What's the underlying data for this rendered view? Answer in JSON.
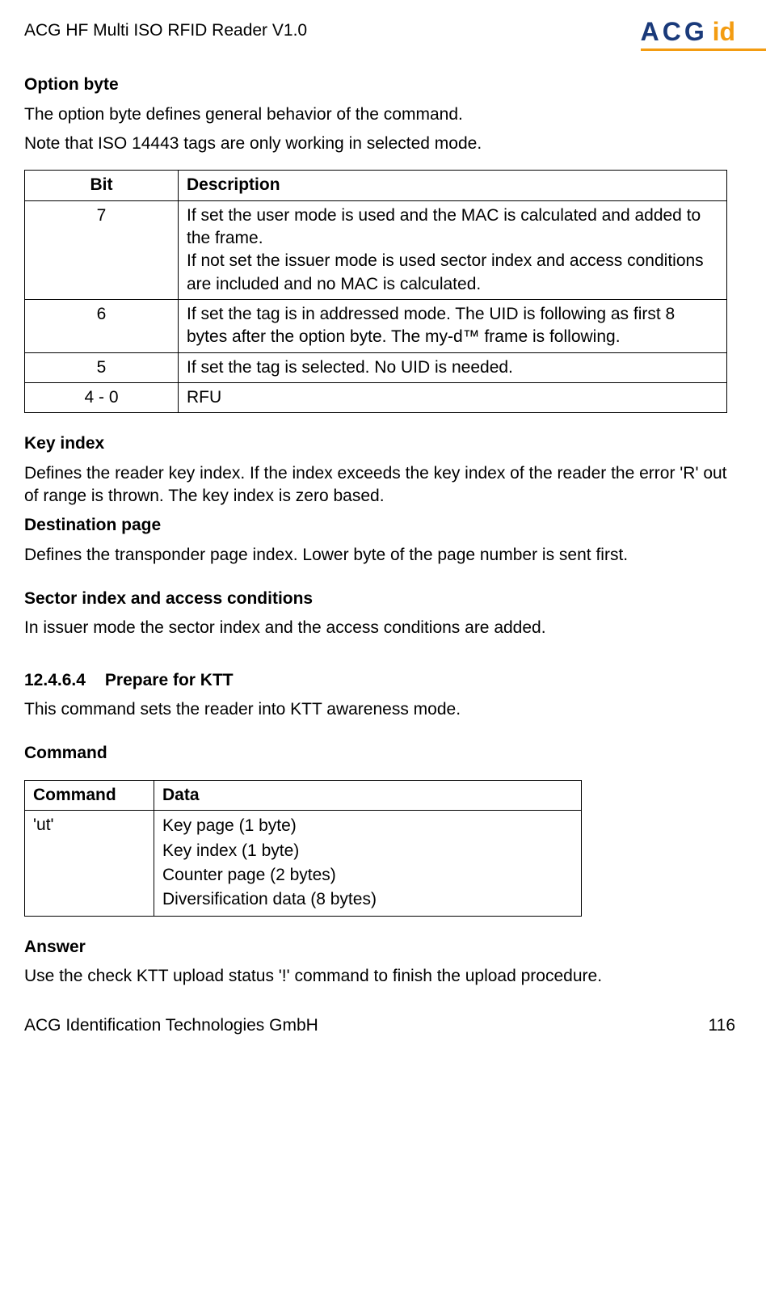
{
  "header": {
    "doc_title": "ACG HF Multi ISO RFID Reader V1.0",
    "logo_text_1": "ACG",
    "logo_text_2": "id"
  },
  "option_byte": {
    "heading": "Option byte",
    "p1": "The option byte defines general behavior of the command.",
    "p2": "Note that ISO 14443 tags are only working in selected mode.",
    "table": {
      "head_bit": "Bit",
      "head_desc": "Description",
      "rows": [
        {
          "bit": "7",
          "desc": "If set the user mode is used and the MAC is calculated and added to the frame.\nIf not set the issuer mode is used sector index and access conditions are included and no MAC is calculated."
        },
        {
          "bit": "6",
          "desc": "If set the tag is in addressed mode. The UID is following as first 8 bytes after the option byte. The my-d™ frame is following."
        },
        {
          "bit": "5",
          "desc": "If set the tag is selected. No UID is needed."
        },
        {
          "bit": "4 - 0",
          "desc": "RFU"
        }
      ]
    }
  },
  "key_index": {
    "heading": "Key index",
    "p": "Defines the reader key index. If the index exceeds the key index of the reader the error 'R' out of range is thrown. The key index is zero based."
  },
  "destination_page": {
    "heading": "Destination page",
    "p": "Defines the transponder page index. Lower byte of the page number is sent first."
  },
  "sector": {
    "heading": "Sector index and access conditions",
    "p": "In issuer mode the sector index and the access conditions are added."
  },
  "prepare_ktt": {
    "num": "12.4.6.4",
    "title": "Prepare for KTT",
    "p": "This command sets the reader into KTT awareness mode."
  },
  "command": {
    "heading": "Command",
    "table": {
      "head_cmd": "Command",
      "head_data": "Data",
      "cmd_value": "'ut'",
      "data_lines": [
        "Key page (1 byte)",
        "Key index (1 byte)",
        "Counter page (2 bytes)",
        "Diversification data (8 bytes)"
      ]
    }
  },
  "answer": {
    "heading": "Answer",
    "p": "Use the check KTT upload status '!' command to finish the upload procedure."
  },
  "footer": {
    "company": "ACG Identification Technologies GmbH",
    "page": "116"
  }
}
